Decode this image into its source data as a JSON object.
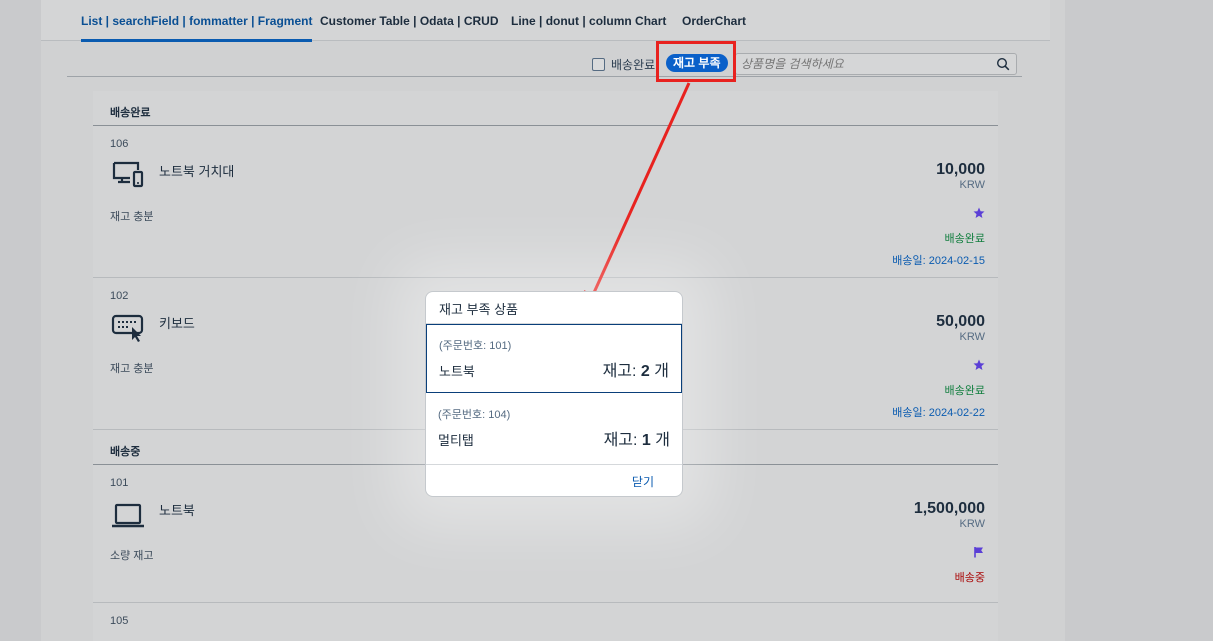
{
  "tabs": [
    {
      "label": "List | searchField | fommatter | Fragment",
      "active": true
    },
    {
      "label": "Customer Table | Odata | CRUD",
      "active": false
    },
    {
      "label": "Line | donut | column Chart",
      "active": false
    },
    {
      "label": "OrderChart",
      "active": false
    }
  ],
  "toolbar": {
    "checkbox_label": "배송완료",
    "shortage_button": "재고 부족",
    "search_placeholder": "상품명을 검색하세요"
  },
  "groups": [
    {
      "title": "배송완료",
      "items": [
        {
          "id": "106",
          "name": "노트북 거치대",
          "stock_text": "재고 충분",
          "price": "10,000",
          "currency": "KRW",
          "status": "배송완료",
          "date": "배송일: 2024-02-15",
          "icon": "laptop-phone-icon",
          "mark": "star-icon"
        },
        {
          "id": "102",
          "name": "키보드",
          "stock_text": "재고 충분",
          "price": "50,000",
          "currency": "KRW",
          "status": "배송완료",
          "date": "배송일: 2024-02-22",
          "icon": "keyboard-icon",
          "mark": "star-icon"
        }
      ]
    },
    {
      "title": "배송중",
      "items": [
        {
          "id": "101",
          "name": "노트북",
          "stock_text": "소량 재고",
          "price": "1,500,000",
          "currency": "KRW",
          "status": "배송중",
          "icon": "laptop-icon",
          "mark": "flag-icon"
        },
        {
          "id": "105"
        }
      ]
    }
  ],
  "colors": {
    "status_done": "#107e3e",
    "status_shipping": "#aa0808",
    "mark": "#5b3fd6",
    "accent": "#0a60c9",
    "highlight": "#e8221f"
  },
  "dialog": {
    "title": "재고 부족 상품",
    "items": [
      {
        "order": "(주문번호: 101)",
        "name": "노트북",
        "stock_label": "재고:",
        "stock_qty": "2",
        "unit": "개"
      },
      {
        "order": "(주문번호: 104)",
        "name": "멀티탭",
        "stock_label": "재고:",
        "stock_qty": "1",
        "unit": "개"
      }
    ],
    "close": "닫기"
  }
}
